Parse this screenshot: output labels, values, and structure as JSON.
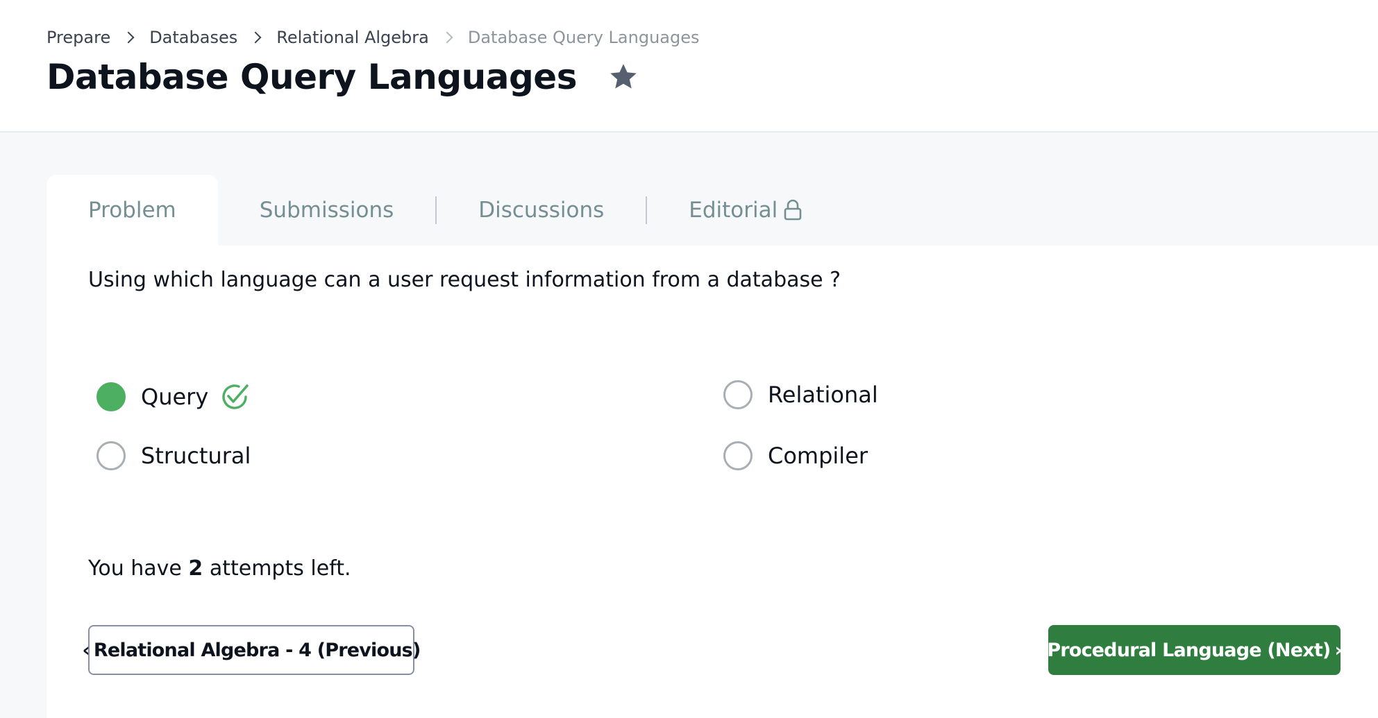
{
  "breadcrumb": {
    "items": [
      "Prepare",
      "Databases",
      "Relational Algebra"
    ],
    "current": "Database Query Languages"
  },
  "page": {
    "title": "Database Query Languages",
    "star_icon": "star-icon"
  },
  "tabs": [
    {
      "label": "Problem",
      "active": true
    },
    {
      "label": "Submissions",
      "active": false
    },
    {
      "label": "Discussions",
      "active": false
    },
    {
      "label": "Editorial",
      "active": false,
      "icon": "lock-icon"
    }
  ],
  "question": {
    "text": "Using which language can a user request information from a database ?",
    "options": [
      {
        "label": "Query",
        "selected": true,
        "correct": true
      },
      {
        "label": "Relational",
        "selected": false
      },
      {
        "label": "Structural",
        "selected": false
      },
      {
        "label": "Compiler",
        "selected": false
      }
    ]
  },
  "attempts": {
    "prefix": "You have",
    "count": "2",
    "suffix": "attempts left."
  },
  "navigation": {
    "prev_chevron": "‹",
    "prev_label": "Relational Algebra - 4 (Previous)",
    "next_label": "Procedural Language (Next)",
    "next_chevron": "›"
  },
  "colors": {
    "accent_green": "#4caf61",
    "button_green": "#2f7d3f",
    "tab_text": "#738f93"
  }
}
